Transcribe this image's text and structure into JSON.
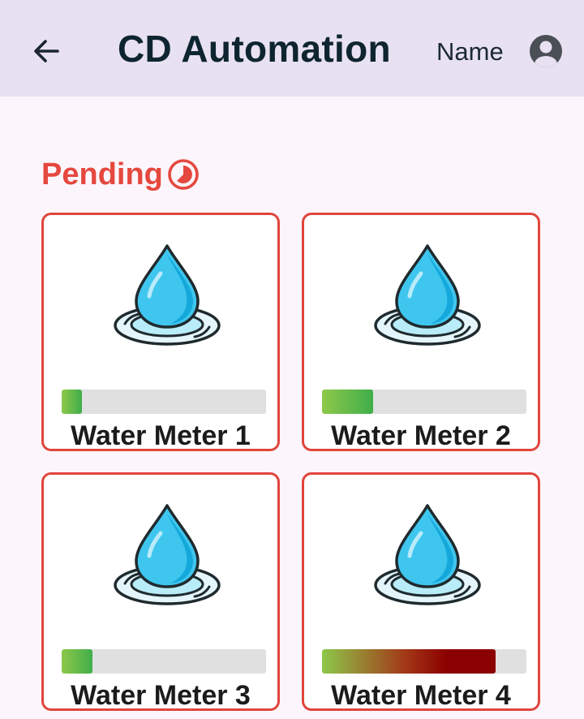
{
  "appbar": {
    "back_icon": "arrow-left-icon",
    "title": "CD Automation",
    "user_name": "Name",
    "account_icon": "account-circle-icon"
  },
  "section": {
    "label": "Pending",
    "icon": "pie-progress-icon",
    "accent_color": "#e5483e"
  },
  "meters": [
    {
      "label": "Water Meter 1",
      "icon": "water-drop-icon",
      "progress": 0.1,
      "fill_style": "green"
    },
    {
      "label": "Water Meter 2",
      "icon": "water-drop-icon",
      "progress": 0.25,
      "fill_style": "green"
    },
    {
      "label": "Water Meter 3",
      "icon": "water-drop-icon",
      "progress": 0.15,
      "fill_style": "green"
    },
    {
      "label": "Water Meter 4",
      "icon": "water-drop-icon",
      "progress": 0.85,
      "fill_style": "green-to-dark-red"
    }
  ],
  "colors": {
    "appbar_bg": "#e8e1f1",
    "page_bg": "#fcf5fc",
    "card_border": "#e0453c",
    "progress_track": "#e0e0e0",
    "progress_green": "#4caf50",
    "progress_critical": "#8b0000"
  }
}
